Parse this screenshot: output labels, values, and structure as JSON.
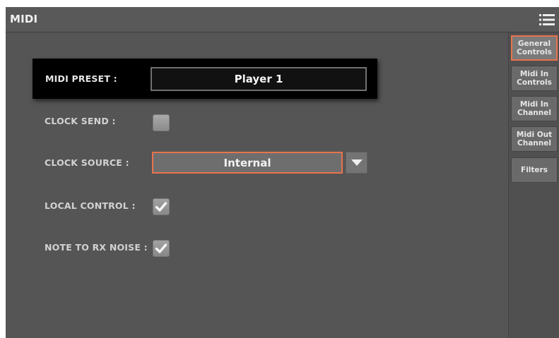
{
  "window": {
    "title": "MIDI",
    "menu_icon": "menu-list-icon"
  },
  "tabs": [
    {
      "label": "General\nControls",
      "active": true
    },
    {
      "label": "Midi In\nControls",
      "active": false
    },
    {
      "label": "Midi In\nChannel",
      "active": false
    },
    {
      "label": "Midi Out\nChannel",
      "active": false
    },
    {
      "label": "Filters",
      "active": false
    }
  ],
  "settings": {
    "midi_preset": {
      "label": "MIDI PRESET :",
      "value": "Player 1"
    },
    "clock_send": {
      "label": "CLOCK SEND :",
      "checked": false
    },
    "clock_source": {
      "label": "CLOCK SOURCE :",
      "value": "Internal"
    },
    "local_control": {
      "label": "LOCAL CONTROL :",
      "checked": true
    },
    "note_to_rx_noise": {
      "label": "NOTE TO RX NOISE :",
      "checked": true
    }
  },
  "colors": {
    "accent": "#e8734d",
    "background": "#555555",
    "highlight_panel": "#000000"
  }
}
